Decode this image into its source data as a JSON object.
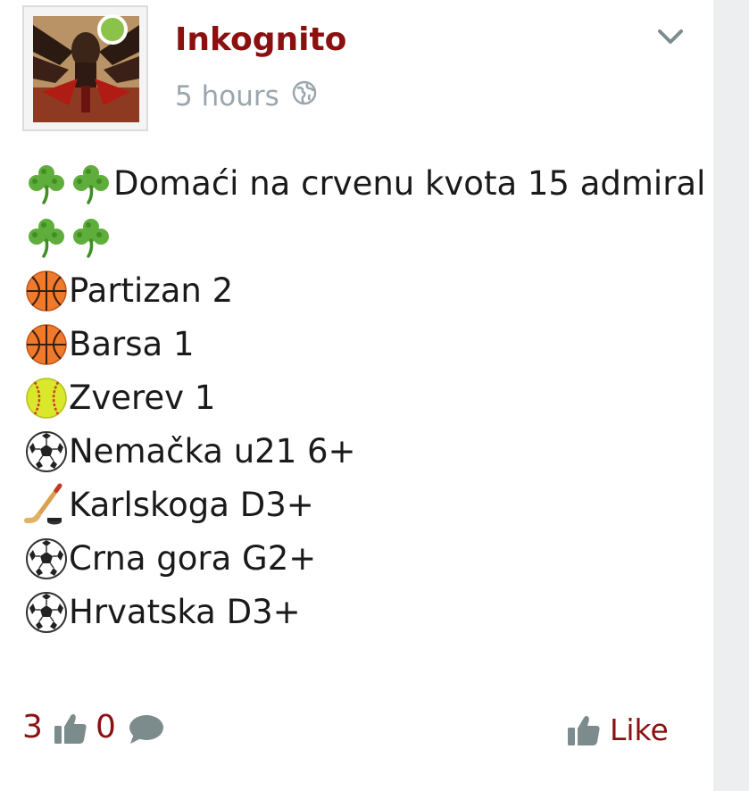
{
  "post": {
    "author": "Inkognito",
    "time": "5 hours",
    "visibility_icon": "globe-icon",
    "online_status_color": "#8bc34a",
    "menu_icon": "chevron-down-icon",
    "lines": [
      {
        "icons": [
          "shamrock-icon",
          "shamrock-icon"
        ],
        "text": "Domaći na crvenu kvota 15 admiral"
      },
      {
        "icons": [
          "shamrock-icon",
          "shamrock-icon"
        ],
        "text": ""
      },
      {
        "icons": [
          "basketball-icon"
        ],
        "text": "Partizan 2"
      },
      {
        "icons": [
          "basketball-icon"
        ],
        "text": "Barsa 1"
      },
      {
        "icons": [
          "softball-icon"
        ],
        "text": "Zverev 1"
      },
      {
        "icons": [
          "soccer-ball-icon"
        ],
        "text": "Nemačka u21 6+"
      },
      {
        "icons": [
          "hockey-stick-icon"
        ],
        "text": "Karlskoga D3+"
      },
      {
        "icons": [
          "soccer-ball-icon"
        ],
        "text": "Crna gora G2+"
      },
      {
        "icons": [
          "soccer-ball-icon"
        ],
        "text": "Hrvatska D3+"
      }
    ]
  },
  "footer": {
    "likes_count": "3",
    "comments_count": "0",
    "like_label": "Like"
  },
  "colors": {
    "accent": "#8b1010",
    "muted": "#9aa5ad",
    "icon_gray": "#7c8c8c"
  }
}
